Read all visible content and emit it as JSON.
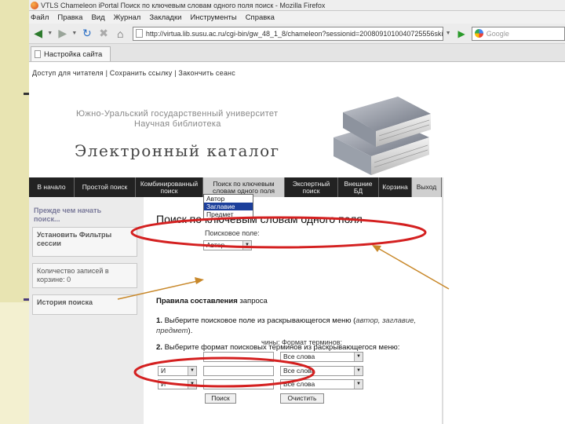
{
  "window": {
    "title": "VTLS Chameleon iPortal Поиск по ключевым словам одного поля поиск - Mozilla Firefox"
  },
  "menu": [
    "Файл",
    "Правка",
    "Вид",
    "Журнал",
    "Закладки",
    "Инструменты",
    "Справка"
  ],
  "toolbar": {
    "url": "http://virtua.lib.susu.ac.ru/cgi-bin/gw_48_1_8/chameleon?sessionid=2008091010040725556skin=defaul",
    "search_placeholder": "Google"
  },
  "tab": {
    "label": "Настройка сайта"
  },
  "page": {
    "top_links": "Доступ для читателя | Сохранить ссылку | Закончить сеанс",
    "university_line1": "Южно-Уральский государственный университет",
    "university_line2": "Научная библиотека",
    "catalog_title": "Электронный каталог",
    "nav": [
      {
        "label": "В начало",
        "active": false
      },
      {
        "label": "Простой поиск",
        "active": false
      },
      {
        "label": "Комбинированный поиск",
        "active": false
      },
      {
        "label": "Поиск по ключевым словам одного поля",
        "active": true
      },
      {
        "label": "Экспертный поиск",
        "active": false
      },
      {
        "label": "Внешние БД",
        "active": false
      },
      {
        "label": "Корзина",
        "active": false
      },
      {
        "label": "Выход",
        "active": false
      }
    ],
    "sidebar": {
      "intro": "Прежде чем начать поиск...",
      "filters": "Установить Фильтры сессии",
      "cart_count": "Количество записей в корзине: 0",
      "history": "История поиска"
    },
    "main": {
      "heading": "Поиск по ключевым словам одного поля",
      "search_field_label": "Поисковое поле:",
      "terms_label": "Формат терминов:",
      "terms_label_prefix": "чины:",
      "field_select_value": "Автор",
      "dropdown_options": [
        "Автор",
        "Заглавие",
        "Предмет"
      ],
      "dropdown_highlight": "Заглавие",
      "operator_value": "И",
      "format_value": "Все слова",
      "search_button": "Поиск",
      "clear_button": "Очистить",
      "rules_title_bold": "Правила составления",
      "rules_title_rest": " запроса",
      "rule1_prefix": "1.",
      "rule1_text": "Выберите поисковое поле из раскрывающегося меню (",
      "rule1_italic": "автор, заглавие, предмет",
      "rule1_end": ").",
      "rule2_prefix": "2.",
      "rule2_text": "Выберите формат поисковых терминов из раскрывающегося меню:"
    }
  },
  "colors": {
    "annotation_red": "#d42020",
    "annotation_arrow": "#c8882a",
    "dropdown_highlight": "#1c3f9b",
    "nav_background": "#222222"
  }
}
